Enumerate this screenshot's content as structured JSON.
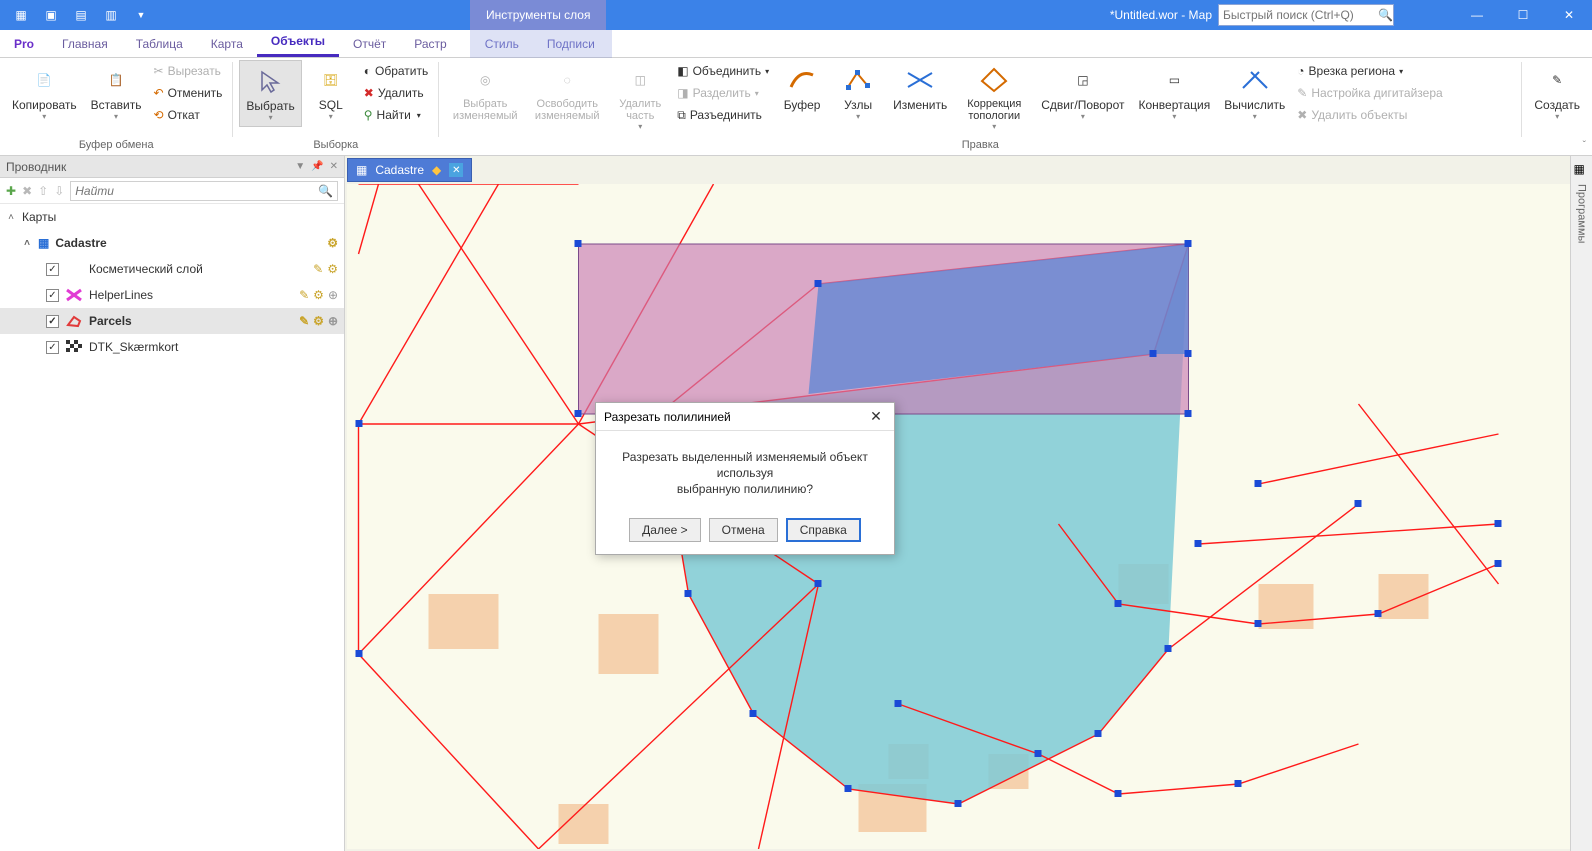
{
  "titlebar": {
    "context_tab": "Инструменты слоя",
    "title": "*Untitled.wor - Мар",
    "search_placeholder": "Быстрый поиск (Ctrl+Q)"
  },
  "tabs": {
    "pro": "Pro",
    "home": "Главная",
    "table": "Таблица",
    "map": "Карта",
    "objects": "Объекты",
    "report": "Отчёт",
    "raster": "Растр",
    "style": "Стиль",
    "labels": "Подписи"
  },
  "ribbon": {
    "clipboard": {
      "copy": "Копировать",
      "paste": "Вставить",
      "cut": "Вырезать",
      "undo": "Отменить",
      "rollback": "Откат",
      "label": "Буфер обмена"
    },
    "selection": {
      "select": "Выбрать",
      "sql": "SQL",
      "invert": "Обратить",
      "delete": "Удалить",
      "find": "Найти",
      "label": "Выборка"
    },
    "edit": {
      "select_editable": "Выбрать изменяемый",
      "release_editable": "Освободить изменяемый",
      "delete_part": "Удалить часть",
      "combine": "Объединить",
      "split": "Разделить",
      "disaggregate": "Разъединить",
      "buffer": "Буфер",
      "nodes": "Узлы",
      "reshape": "Изменить",
      "topology": "Коррекция топологии",
      "move_rotate": "Сдвиг/Поворот",
      "convert": "Конвертация",
      "calc": "Вычислить",
      "region_cut": "Врезка региона",
      "digitizer": "Настройка дигитайзера",
      "del_objects": "Удалить объекты",
      "label": "Правка"
    },
    "create": {
      "create": "Создать"
    }
  },
  "explorer": {
    "title": "Проводник",
    "search_placeholder": "Найти",
    "section": "Карты",
    "map_name": "Cadastre",
    "layers": {
      "cosmetic": "Косметический слой",
      "helper": "HelperLines",
      "parcels": "Parcels",
      "dtk": "DTK_Skærmkort"
    }
  },
  "maptab": {
    "name": "Cadastre"
  },
  "dialog": {
    "title": "Разрезать полилинией",
    "message1": "Разрезать выделенный изменяемый объект используя",
    "message2": "выбранную полилинию?",
    "next": "Далее >",
    "cancel": "Отмена",
    "help": "Справка"
  },
  "sidestrip": {
    "label": "Программы"
  }
}
